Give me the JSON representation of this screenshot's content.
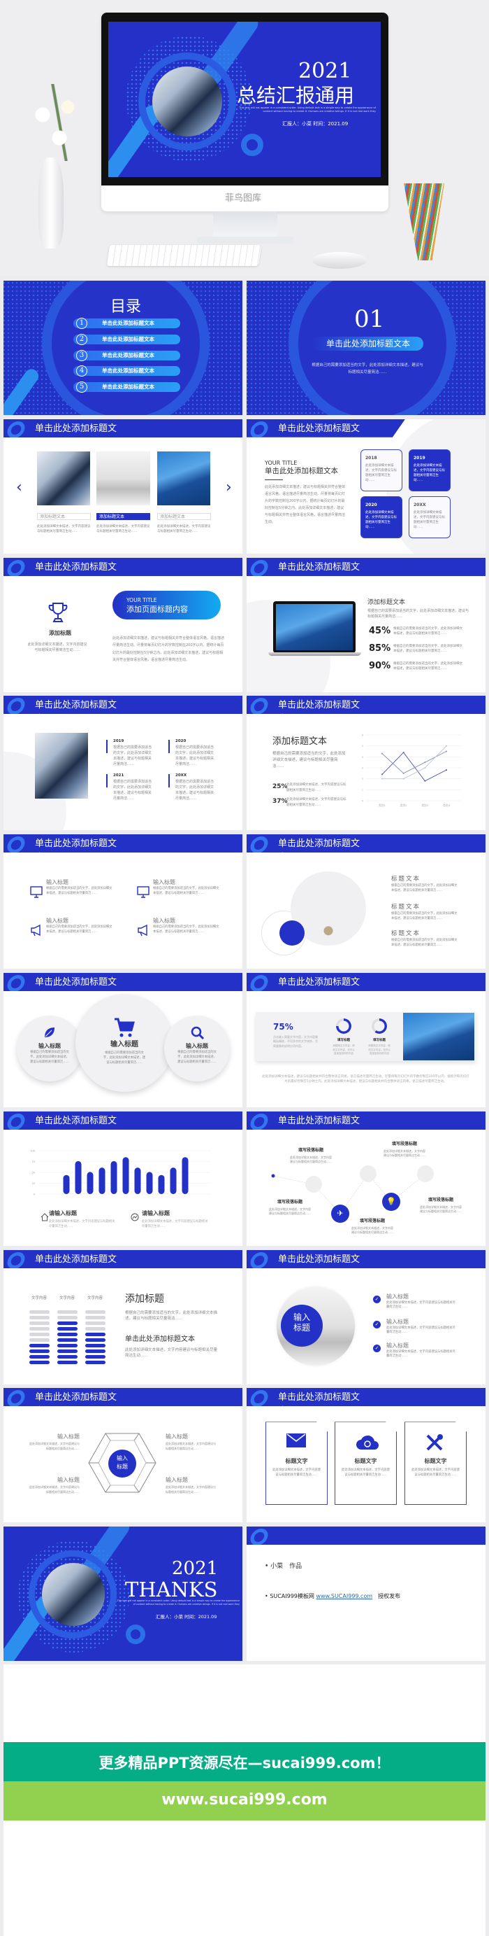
{
  "colors": {
    "brand_blue": "#2331c6",
    "light_blue": "#2aa0f5",
    "teal": "#05ad86",
    "lime": "#92d050",
    "page_bg": "#ececef"
  },
  "hero": {
    "year": "2021",
    "title": "总结汇报通用",
    "english": "This text will not appear in a consistent order. Using default text is a simple way to create the appearance of content without having to create it. Humans are creative beings. If it is not real work they",
    "reporter": "汇报人：小菜  时间：2021.09",
    "monitor_brand": "菲鸟图库"
  },
  "header_title": "单击此处添加标题文本",
  "toc": {
    "title": "目录",
    "items": [
      {
        "num": "1",
        "label": "单击此处添加标题文本"
      },
      {
        "num": "2",
        "label": "单击此处添加标题文本"
      },
      {
        "num": "3",
        "label": "单击此处添加标题文本"
      },
      {
        "num": "4",
        "label": "单击此处添加标题文本"
      },
      {
        "num": "5",
        "label": "单击此处添加标题文本"
      }
    ]
  },
  "section": {
    "number": "01",
    "title": "单击此处添加标题文本",
    "desc": "根据自己的需要添加适当的文字，此处添加详细文本描述，建议与标题相关尽量简洁……"
  },
  "gallery": {
    "prev": "‹",
    "next": "›",
    "items": [
      {
        "label": "添加标题文本",
        "desc": "此处添加详细文本描述，文字内容建议与标题相关尽量简洁生动……"
      },
      {
        "label": "添加标题文本",
        "desc": "此处添加详细文本描述，文字内容建议与标题相关尽量简洁生动……"
      },
      {
        "label": "添加标题文本",
        "desc": "此处添加详细文本描述，文字内容建议与标题相关尽量简洁生动……"
      }
    ]
  },
  "yearcards": {
    "kicker": "YOUR TITLE",
    "title": "单击此处添加标题文本",
    "para": "此处添加详细文本描述，建议与标题相关并符合整体语言风格，语言描述尽量简洁生动。尽量将每页幻灯片的字数控制在200字以内，据统计每页幻灯片的最好控制在5分钟之内。此处添加详细文本描述，建议与标题相关并符合整体语言风格，语言描述尽量简洁生动。",
    "cards": [
      {
        "year": "2018",
        "desc": "此处添加详细文本描述，文字内容建议与标题相关尽量简洁生动……"
      },
      {
        "year": "2019",
        "desc": "此处添加详细文本描述，文字内容建议与标题相关尽量简洁生动……"
      },
      {
        "year": "2020",
        "desc": "此处添加详细文本描述，文字内容建议与标题相关尽量简洁生动……"
      },
      {
        "year": "20XX",
        "desc": "此处添加详细文本描述，文字内容建议与标题相关尽量简洁生动……"
      }
    ]
  },
  "trophy": {
    "title": "添加标题",
    "desc": "此处添加详细文本描述，文字内容建议与标题相关尽量简洁生动……",
    "pill_kicker": "YOUR TITLE",
    "pill_title": "添加页面标题内容",
    "para": "此处添加详细文本描述，建议与标题相关并符合整体语言风格，语言描述尽量简洁生动。尽量将每页幻灯片的字数控制在200字以内，据统计每页幻灯片的最好控制在5分钟之内。此处添加详细文本描述，建议与标题相关并符合整体语言风格，语言描述尽量简洁生动。"
  },
  "laptop": {
    "title": "添加标题文本",
    "desc": "根据自己的需要添加适当的文字，此处添加详细文本描述，建议与标题相关尽量简洁……",
    "stats": [
      {
        "value": "45%",
        "desc": "根据自己的需要添加适当的文字，此处添加详细文本描述，建议与标题相关尽量简洁……"
      },
      {
        "value": "85%",
        "desc": "根据自己的需要添加适当的文字，此处添加详细文本描述，建议与标题相关尽量简洁……"
      },
      {
        "value": "90%",
        "desc": "根据自己的需要添加适当的文字，此处添加详细文本描述，建议与标题相关尽量简洁……"
      }
    ]
  },
  "timeline": {
    "items": [
      {
        "year": "2019",
        "desc": "根据自己的需要添加适当的文字，此处添加详细文本描述，建议与标题相关尽量简洁……"
      },
      {
        "year": "2020",
        "desc": "根据自己的需要添加适当的文字，此处添加详细文本描述，建议与标题相关尽量简洁……"
      },
      {
        "year": "2021",
        "desc": "根据自己的需要添加适当的文字，此处添加详细文本描述，建议与标题相关尽量简洁……"
      },
      {
        "year": "20XX",
        "desc": "根据自己的需要添加适当的文字，此处添加详细文本描述，建议与标题相关尽量简洁……"
      }
    ]
  },
  "linechart_slide": {
    "title": "添加标题文本",
    "desc": "根据自己的需要添加适当的文字，此处添加详细文本描述，建议与标题相关尽量简洁……",
    "stats": [
      {
        "value": "25%",
        "desc": "此处添加详细文本描述，文字内容建议与标题相关尽量简洁生动……"
      },
      {
        "value": "37%",
        "desc": "此处添加详细文本描述，文字内容建议与标题相关尽量简洁生动……"
      }
    ]
  },
  "icons4": {
    "items": [
      {
        "icon": "monitor-icon",
        "title": "输入标题",
        "desc": "根据自己的需要添加适当的文字，此处添加详细文本描述，建议与标题相关尽量简洁……"
      },
      {
        "icon": "monitor-icon",
        "title": "输入标题",
        "desc": "根据自己的需要添加适当的文字，此处添加详细文本描述，建议与标题相关尽量简洁……"
      },
      {
        "icon": "megaphone-icon",
        "title": "输入标题",
        "desc": "根据自己的需要添加适当的文字，此处添加详细文本描述，建议与标题相关尽量简洁……"
      },
      {
        "icon": "megaphone-icon",
        "title": "输入标题",
        "desc": "根据自己的需要添加适当的文字，此处添加详细文本描述，建议与标题相关尽量简洁……"
      }
    ]
  },
  "circles_text": {
    "items": [
      {
        "title": "标题文本",
        "desc": "根据自己的需要添加适当的文字，此处添加详细文本描述，建议与标题相关尽量简洁……"
      },
      {
        "title": "标题文本",
        "desc": "根据自己的需要添加适当的文字，此处添加详细文本描述，建议与标题相关尽量简洁……"
      },
      {
        "title": "标题文本",
        "desc": "根据自己的需要添加适当的文字，此处添加详细文本描述，建议与标题相关尽量简洁……"
      }
    ]
  },
  "bubbles": {
    "items": [
      {
        "icon": "leaf-icon",
        "title": "输入标题",
        "desc": "根据自己的需要添加适当的文字，此处添加详细文本描述，建议与标题相关尽量简洁……"
      },
      {
        "icon": "cart-icon",
        "title": "输入标题",
        "desc": "根据自己的需要添加适当的文字，此处添加详细文本描述，建议与标题相关尽量简洁……"
      },
      {
        "icon": "search-icon",
        "title": "输入标题",
        "desc": "根据自己的需要添加适当的文字，此处添加详细文本描述，建议与标题相关尽量简洁……"
      }
    ]
  },
  "progress_card": {
    "value": "75%",
    "desc": "点击输入简要文字内容，文字内容需概括精炼，不用多余的文字修饰，言简意赅的说明分项内容。",
    "rings": [
      {
        "label": "填写标题",
        "desc": "请替换文字内容，修改文字内容，也可以直接复制你的内容",
        "progress": 0.75
      },
      {
        "label": "填写标题",
        "desc": "请替换文字内容，修改文字内容，也可以直接复制你的内容",
        "progress": 0.6
      }
    ],
    "para": "此处添加详细文本描述，建议与标题相关并符合整体语言风格，语言描述尽量简洁生动。尽量将每页幻灯片的字数控制在200字以内，据统计每页幻灯片的最好控制在5分钟之内。此处添加详细文本描述，建议与标题相关并符合整体语言风格，语言描述尽量简洁生动。"
  },
  "barchart_slide": {
    "items": [
      {
        "icon": "home-icon",
        "title": "请输入标题",
        "desc": "此处添加详细文本描述，文字内容建议与标题相关尽量简洁生动……"
      },
      {
        "icon": "chart-icon",
        "title": "请输入标题",
        "desc": "此处添加详细文本描述，文字内容建议与标题相关尽量简洁生动……"
      }
    ]
  },
  "process": {
    "items": [
      {
        "title": "填写段落标题",
        "desc": "此处添加详细文本描述，文字内容建议与标题相关尽量简洁生动……"
      },
      {
        "title": "填写段落标题",
        "desc": "此处添加详细文本描述，文字内容建议与标题相关尽量简洁生动……"
      },
      {
        "title": "填写段落标题",
        "desc": "此处添加详细文本描述，文字内容建议与标题相关尽量简洁生动……"
      },
      {
        "title": "填写段落标题",
        "desc": "此处添加详细文本描述，文字内容建议与标题相关尽量简洁生动……"
      },
      {
        "title": "填写段落标题",
        "desc": "此处添加详细文本描述，文字内容建议与标题相关尽量简洁生动……"
      }
    ]
  },
  "stacks": {
    "columns": [
      {
        "label": "文字内容",
        "level": 4
      },
      {
        "label": "文字内容",
        "level": 8
      },
      {
        "label": "文字内容",
        "level": 6
      }
    ],
    "total": 10,
    "title": "添加标题",
    "desc": "根据自己的需要添加适当的文字，此处添加详细文本描述，建议与标题相关尽量简洁……",
    "subtitle": "单击此处添加标题文本",
    "subdesc": "此处添加详细文本描述，文字内容建议与标题相关尽量简洁生动……"
  },
  "checklist": {
    "center": "输入标题",
    "items": [
      {
        "title": "输入标题",
        "desc": "此处添加详细文本描述，文字内容建议与标题相关尽量简洁生动……"
      },
      {
        "title": "输入标题",
        "desc": "此处添加详细文本描述，文字内容建议与标题相关尽量简洁生动……"
      },
      {
        "title": "输入标题",
        "desc": "此处添加详细文本描述，文字内容建议与标题相关尽量简洁生动……"
      }
    ]
  },
  "hexagon": {
    "center": "输入标题",
    "items": [
      {
        "title": "输入标题",
        "desc": "此处添加详细文本描述，文字内容建议与标题相关尽量简洁生动……"
      },
      {
        "title": "输入标题",
        "desc": "此处添加详细文本描述，文字内容建议与标题相关尽量简洁生动……"
      },
      {
        "title": "输入标题",
        "desc": "此处添加详细文本描述，文字内容建议与标题相关尽量简洁生动……"
      },
      {
        "title": "输入标题",
        "desc": "此处添加详细文本描述，文字内容建议与标题相关尽量简洁生动……"
      }
    ]
  },
  "doccards": {
    "items": [
      {
        "icon": "mail-icon",
        "title": "标题文字",
        "desc": "此处添加详细文本描述，文字内容建议与标题相关尽量简洁生动……"
      },
      {
        "icon": "cloud-refresh-icon",
        "title": "标题文字",
        "desc": "此处添加详细文本描述，文字内容建议与标题相关尽量简洁生动……"
      },
      {
        "icon": "tools-icon",
        "title": "标题文字",
        "desc": "此处添加详细文本描述，文字内容建议与标题相关尽量简洁生动……"
      }
    ]
  },
  "thanks": {
    "year": "2021",
    "title": "THANKS",
    "english": "This text will not appear in a consistent order. Using default text is a simple way to create the appearance of content without having to create it. Humans are creative beings. If it is not real work they",
    "reporter": "汇报人：小菜  时间：2021.09"
  },
  "credits": {
    "line1": "• 小菜　作品",
    "line2_prefix": "• SUCAI999模板网 ",
    "link": "www.SUCAI999.com",
    "line2_suffix": "　授权发布"
  },
  "banner": {
    "line1": "更多精品PPT资源尽在—sucai999.com！",
    "line2": "www.sucai999.com"
  },
  "chart_data": [
    {
      "type": "bar",
      "title": "",
      "categories": [
        "1",
        "2",
        "3",
        "4",
        "5",
        "6",
        "7",
        "8",
        "9",
        "10",
        "11"
      ],
      "values": [
        44,
        76,
        51,
        61,
        76,
        85,
        61,
        51,
        44,
        61,
        85
      ],
      "ylim": [
        0,
        100
      ],
      "yticks": [
        0,
        25,
        50,
        75,
        100
      ],
      "grid": true
    },
    {
      "type": "line",
      "title": "",
      "categories": [
        "类别1",
        "类别2",
        "类别3",
        "类别4"
      ],
      "series": [
        {
          "values": [
            2.4,
            4.4,
            1.8,
            2.8
          ],
          "color": "#4a52a8"
        },
        {
          "values": [
            4.3,
            2.5,
            3.5,
            4.5
          ],
          "color": "#8a8fb8"
        },
        {
          "values": [
            2.0,
            2.0,
            3.0,
            5.0
          ],
          "color": "#c0c4d8"
        }
      ],
      "ylim": [
        0,
        6
      ],
      "yticks": [
        0,
        1,
        2,
        3,
        4,
        5,
        6
      ],
      "grid": true
    }
  ]
}
